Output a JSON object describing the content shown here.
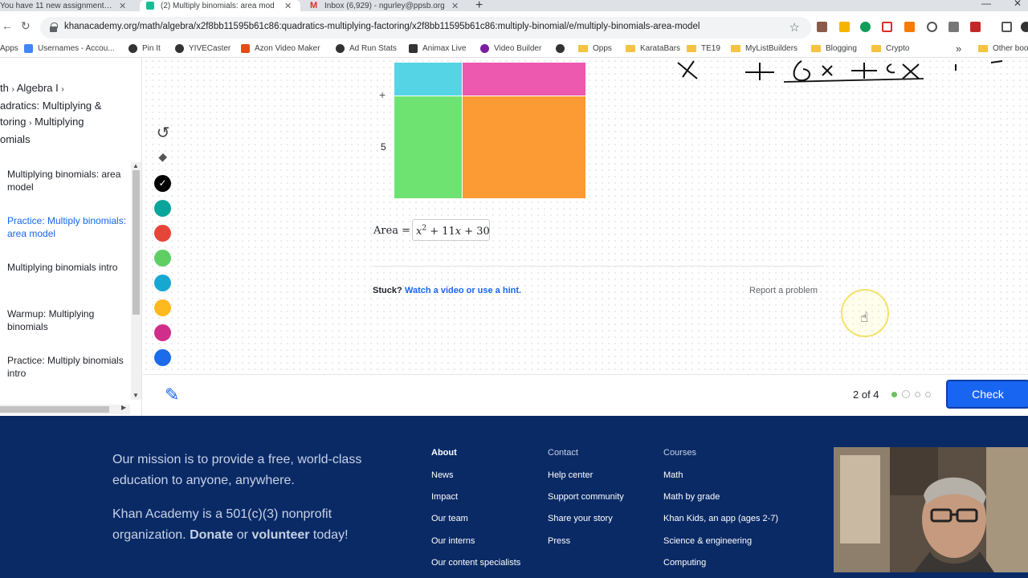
{
  "browser": {
    "tabs": [
      {
        "title": "You have 11 new assignments! - C"
      },
      {
        "title": "(2) Multiply binomials: area mod"
      },
      {
        "title": "Inbox (6,929) - ngurley@ppsb.org"
      }
    ],
    "url": "khanacademy.org/math/algebra/x2f8bb11595b61c86:quadratics-multiplying-factoring/x2f8bb11595b61c86:multiply-binomial/e/multiply-binomials-area-model",
    "bookmarks": [
      "Apps",
      "Usernames - Accou...",
      "Pin It",
      "YIVECaster",
      "Azon Video Maker",
      "Ad Run Stats",
      "Animax Live",
      "Video Builder",
      "",
      "Opps",
      "KarataBars",
      "TE19",
      "MyListBuilders",
      "Blogging",
      "Crypto",
      "Other boo"
    ]
  },
  "sidebar": {
    "breadcrumb": [
      "th",
      "Algebra I",
      "adratics: Multiplying &",
      "toring",
      "Multiplying",
      "omials"
    ],
    "lessons": [
      {
        "label": "Multiplying binomials: area model",
        "active": false
      },
      {
        "label": "Practice: Multiply binomials: area model",
        "active": true
      },
      {
        "label": "Multiplying binomials intro",
        "active": false
      },
      {
        "label": "Warmup: Multiplying binomials",
        "active": false
      },
      {
        "label": "Practice: Multiply binomials intro",
        "active": false
      }
    ]
  },
  "tools": {
    "colors": [
      "#0aa59a",
      "#e6453a",
      "#5fcf65",
      "#17a8d1",
      "#fdb91e",
      "#d12d8b",
      "#1c6bea"
    ]
  },
  "exercise": {
    "side_labels": [
      "+",
      "5"
    ],
    "area_label": "Area =",
    "answer": "x² + 11x + 30",
    "stuck_label": "Stuck?",
    "hint_link": "Watch a video or use a hint.",
    "report_link": "Report a problem",
    "handwriting": "x + 6x + 5x"
  },
  "bottom_bar": {
    "progress": "2 of 4",
    "check_label": "Check"
  },
  "footer": {
    "mission": "Our mission is to provide a free, world-class education to anyone, anywhere.",
    "nonprofit_text": "Khan Academy is a 501(c)(3) nonprofit organization.",
    "donate": "Donate",
    "or": "or",
    "volunteer": "volunteer",
    "today": "today!",
    "about": {
      "heading": "About",
      "links": [
        "News",
        "Impact",
        "Our team",
        "Our interns",
        "Our content specialists"
      ]
    },
    "contact": {
      "heading": "Contact",
      "links": [
        "Help center",
        "Support community",
        "Share your story",
        "Press"
      ]
    },
    "courses": {
      "heading": "Courses",
      "links": [
        "Math",
        "Math by grade",
        "Khan Kids, an app (ages 2-7)",
        "Science & engineering",
        "Computing"
      ]
    }
  }
}
